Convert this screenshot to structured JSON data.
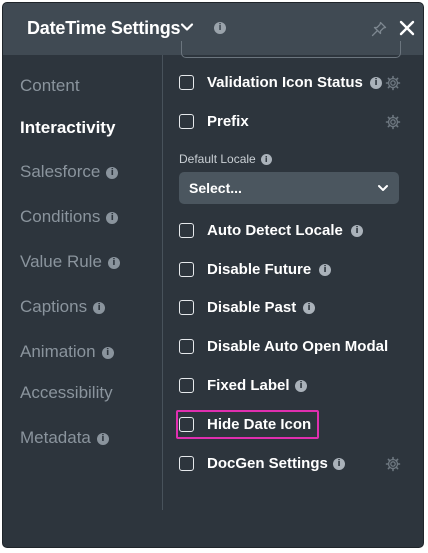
{
  "header": {
    "title": "DateTime Settings",
    "info": "i"
  },
  "nav": {
    "items": [
      {
        "label": "Content",
        "active": false,
        "info": false
      },
      {
        "label": "Interactivity",
        "active": true,
        "info": false
      },
      {
        "label": "Salesforce",
        "active": false,
        "info": true
      },
      {
        "label": "Conditions",
        "active": false,
        "info": true
      },
      {
        "label": "Value Rule",
        "active": false,
        "info": true
      },
      {
        "label": "Captions",
        "active": false,
        "info": true
      },
      {
        "label": "Animation",
        "active": false,
        "info": true
      },
      {
        "label": "Accessibility",
        "active": false,
        "info": false
      },
      {
        "label": "Metadata",
        "active": false,
        "info": true
      }
    ]
  },
  "options": {
    "validation_icon_status": "Validation Icon Status",
    "prefix": "Prefix",
    "default_locale_label": "Default Locale",
    "select_value": "Select...",
    "auto_detect_locale": "Auto Detect Locale",
    "disable_future": "Disable Future",
    "disable_past": "Disable Past",
    "disable_auto_open_modal": "Disable Auto Open Modal",
    "fixed_label": "Fixed Label",
    "hide_date_icon": "Hide Date Icon",
    "docgen_settings": "DocGen Settings"
  },
  "info_glyph": "i",
  "colors": {
    "panel_bg": "#2d353d",
    "header_bg": "#404a53",
    "highlight": "#e02fb0"
  }
}
